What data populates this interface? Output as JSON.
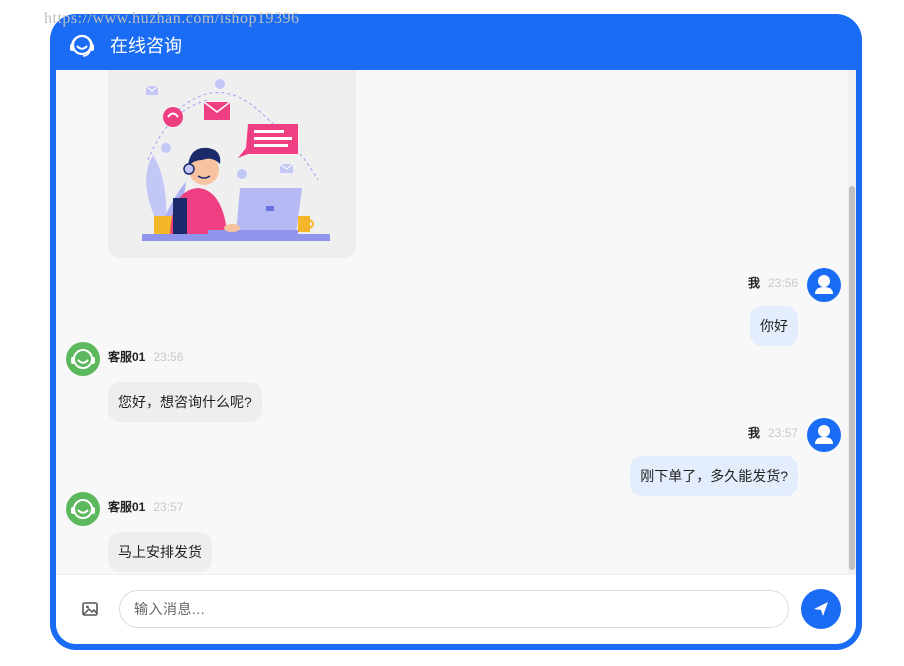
{
  "watermark": "https://www.huzhan.com/ishop19396",
  "header": {
    "title": "在线咨询",
    "logo_icon": "headset-smile-icon"
  },
  "colors": {
    "brand": "#1a6cf5",
    "agent_avatar": "#5cb85c",
    "user_bubble": "#e3edfc",
    "agent_bubble": "#eeeeee"
  },
  "messages": [
    {
      "role": "user",
      "name": "我",
      "time": "23:56",
      "text": "你好"
    },
    {
      "role": "agent",
      "name": "客服01",
      "time": "23:56",
      "text": "您好，想咨询什么呢?"
    },
    {
      "role": "user",
      "name": "我",
      "time": "23:57",
      "text": "刚下单了，多久能发货?"
    },
    {
      "role": "agent",
      "name": "客服01",
      "time": "23:57",
      "text": "马上安排发货"
    }
  ],
  "input": {
    "placeholder": "输入消息...",
    "value": "",
    "image_icon": "image-icon",
    "send_icon": "send-icon"
  }
}
